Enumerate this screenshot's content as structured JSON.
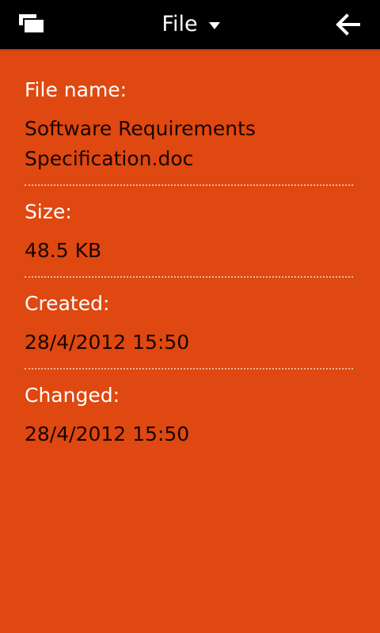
{
  "header": {
    "title": "File",
    "switcher_icon": "task-switcher-icon",
    "back_icon": "back-arrow-icon"
  },
  "details": {
    "file_name": {
      "label": "File name:",
      "value_line1": "Software Requirements",
      "value_line2": "Specification.doc"
    },
    "size": {
      "label": "Size:",
      "value": "48.5 KB"
    },
    "created": {
      "label": "Created:",
      "value": "28/4/2012 15:50"
    },
    "changed": {
      "label": "Changed:",
      "value": "28/4/2012 15:50"
    }
  },
  "colors": {
    "titlebar": "#000000",
    "background": "#df4810",
    "label_text": "#ffffff",
    "value_text": "#1a0500"
  }
}
